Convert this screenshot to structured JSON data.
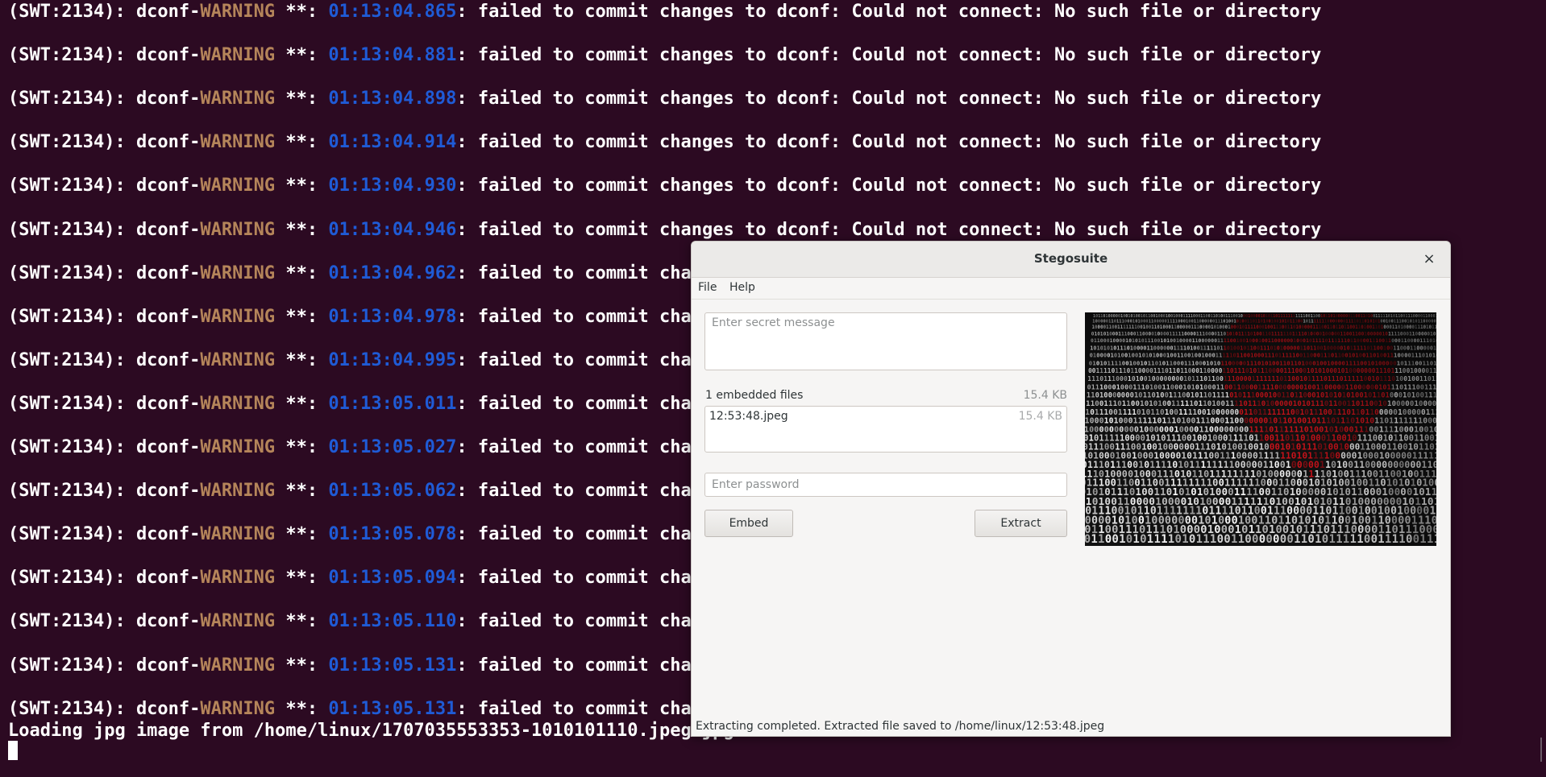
{
  "terminal": {
    "log_lines": [
      {
        "pid": "(SWT:2134): dconf-",
        "level": "WARNING",
        "sep": " **: ",
        "time": "01:13:04.865",
        "msg": ": failed to commit changes to dconf: Could not connect: No such file or directory"
      },
      {
        "pid": "(SWT:2134): dconf-",
        "level": "WARNING",
        "sep": " **: ",
        "time": "01:13:04.881",
        "msg": ": failed to commit changes to dconf: Could not connect: No such file or directory"
      },
      {
        "pid": "(SWT:2134): dconf-",
        "level": "WARNING",
        "sep": " **: ",
        "time": "01:13:04.898",
        "msg": ": failed to commit changes to dconf: Could not connect: No such file or directory"
      },
      {
        "pid": "(SWT:2134): dconf-",
        "level": "WARNING",
        "sep": " **: ",
        "time": "01:13:04.914",
        "msg": ": failed to commit changes to dconf: Could not connect: No such file or directory"
      },
      {
        "pid": "(SWT:2134): dconf-",
        "level": "WARNING",
        "sep": " **: ",
        "time": "01:13:04.930",
        "msg": ": failed to commit changes to dconf: Could not connect: No such file or directory"
      },
      {
        "pid": "(SWT:2134): dconf-",
        "level": "WARNING",
        "sep": " **: ",
        "time": "01:13:04.946",
        "msg": ": failed to commit changes to dconf: Could not connect: No such file or directory"
      },
      {
        "pid": "(SWT:2134): dconf-",
        "level": "WARNING",
        "sep": " **: ",
        "time": "01:13:04.962",
        "msg": ": failed to commit chan"
      },
      {
        "pid": "(SWT:2134): dconf-",
        "level": "WARNING",
        "sep": " **: ",
        "time": "01:13:04.978",
        "msg": ": failed to commit chan"
      },
      {
        "pid": "(SWT:2134): dconf-",
        "level": "WARNING",
        "sep": " **: ",
        "time": "01:13:04.995",
        "msg": ": failed to commit chan"
      },
      {
        "pid": "(SWT:2134): dconf-",
        "level": "WARNING",
        "sep": " **: ",
        "time": "01:13:05.011",
        "msg": ": failed to commit chan"
      },
      {
        "pid": "(SWT:2134): dconf-",
        "level": "WARNING",
        "sep": " **: ",
        "time": "01:13:05.027",
        "msg": ": failed to commit chan"
      },
      {
        "pid": "(SWT:2134): dconf-",
        "level": "WARNING",
        "sep": " **: ",
        "time": "01:13:05.062",
        "msg": ": failed to commit chan"
      },
      {
        "pid": "(SWT:2134): dconf-",
        "level": "WARNING",
        "sep": " **: ",
        "time": "01:13:05.078",
        "msg": ": failed to commit chan"
      },
      {
        "pid": "(SWT:2134): dconf-",
        "level": "WARNING",
        "sep": " **: ",
        "time": "01:13:05.094",
        "msg": ": failed to commit chan"
      },
      {
        "pid": "(SWT:2134): dconf-",
        "level": "WARNING",
        "sep": " **: ",
        "time": "01:13:05.110",
        "msg": ": failed to commit chan"
      },
      {
        "pid": "(SWT:2134): dconf-",
        "level": "WARNING",
        "sep": " **: ",
        "time": "01:13:05.131",
        "msg": ": failed to commit chan"
      },
      {
        "pid": "(SWT:2134): dconf-",
        "level": "WARNING",
        "sep": " **: ",
        "time": "01:13:05.131",
        "msg": ": failed to commit chan"
      }
    ],
    "loading_line": "Loading jpg image from /home/linux/1707035553353-1010101110.jpeg.jpg",
    "colors": {
      "background": "#2c0a22",
      "text": "#ffffff",
      "warning": "#b5855a",
      "timestamp": "#1f5bd6"
    }
  },
  "window": {
    "title": "Stegosuite",
    "close_glyph": "×",
    "menu": {
      "file": "File",
      "help": "Help"
    },
    "message_placeholder": "Enter secret message",
    "embedded_files": {
      "count_label": "1 embedded files",
      "total_size": "15.4 KB",
      "files": [
        {
          "name": "12:53:48.jpeg",
          "size": "15.4 KB"
        }
      ]
    },
    "password_placeholder": "Enter password",
    "embed_label": "Embed",
    "extract_label": "Extract",
    "preview_image": "binary-code-heart-image",
    "status": "Extracting completed. Extracted file saved to /home/linux/12:53:48.jpeg"
  }
}
